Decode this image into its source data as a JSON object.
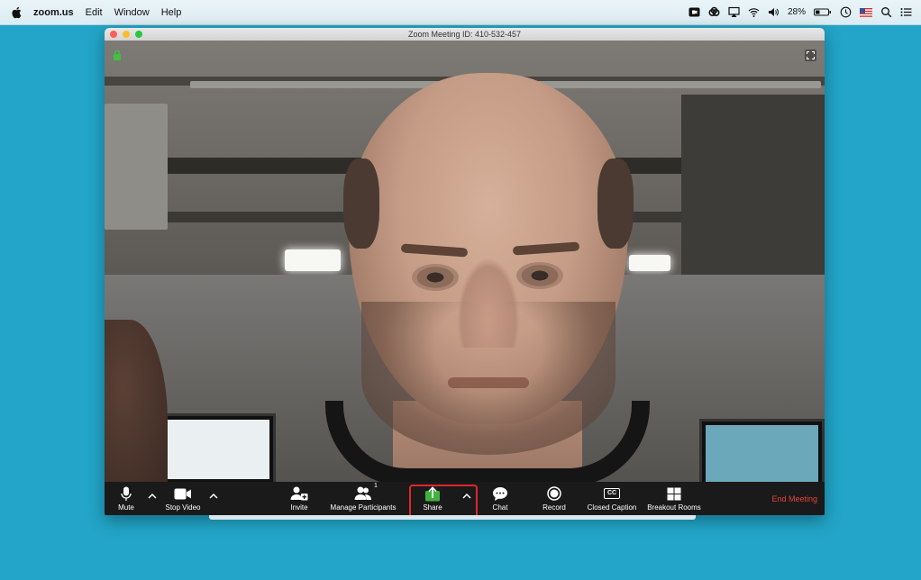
{
  "menubar": {
    "app_name": "zoom.us",
    "menus": [
      "Edit",
      "Window",
      "Help"
    ],
    "battery_percent": "28%"
  },
  "window": {
    "title": "Zoom Meeting ID: 410-532-457"
  },
  "toolbar": {
    "mute_label": "Mute",
    "stop_video_label": "Stop Video",
    "invite_label": "Invite",
    "manage_participants_label": "Manage Participants",
    "participant_count": "1",
    "share_label": "Share",
    "chat_label": "Chat",
    "record_label": "Record",
    "closed_caption_label": "Closed Caption",
    "cc_glyph": "CC",
    "breakout_rooms_label": "Breakout Rooms",
    "end_meeting_label": "End Meeting"
  },
  "colors": {
    "desktop": "#22a5c8",
    "share_icon": "#3fb33f",
    "highlight": "#e0262b",
    "end_meeting": "#e6423a"
  },
  "icons": [
    "apple-icon",
    "camera-icon",
    "creative-cloud-icon",
    "airplay-icon",
    "wifi-icon",
    "volume-icon",
    "battery-icon",
    "time-machine-icon",
    "flag-icon",
    "search-icon",
    "list-icon",
    "lock-icon",
    "fullscreen-icon",
    "microphone-icon",
    "video-icon",
    "invite-icon",
    "participants-icon",
    "share-icon",
    "chat-icon",
    "record-icon",
    "cc-icon",
    "breakout-icon"
  ]
}
